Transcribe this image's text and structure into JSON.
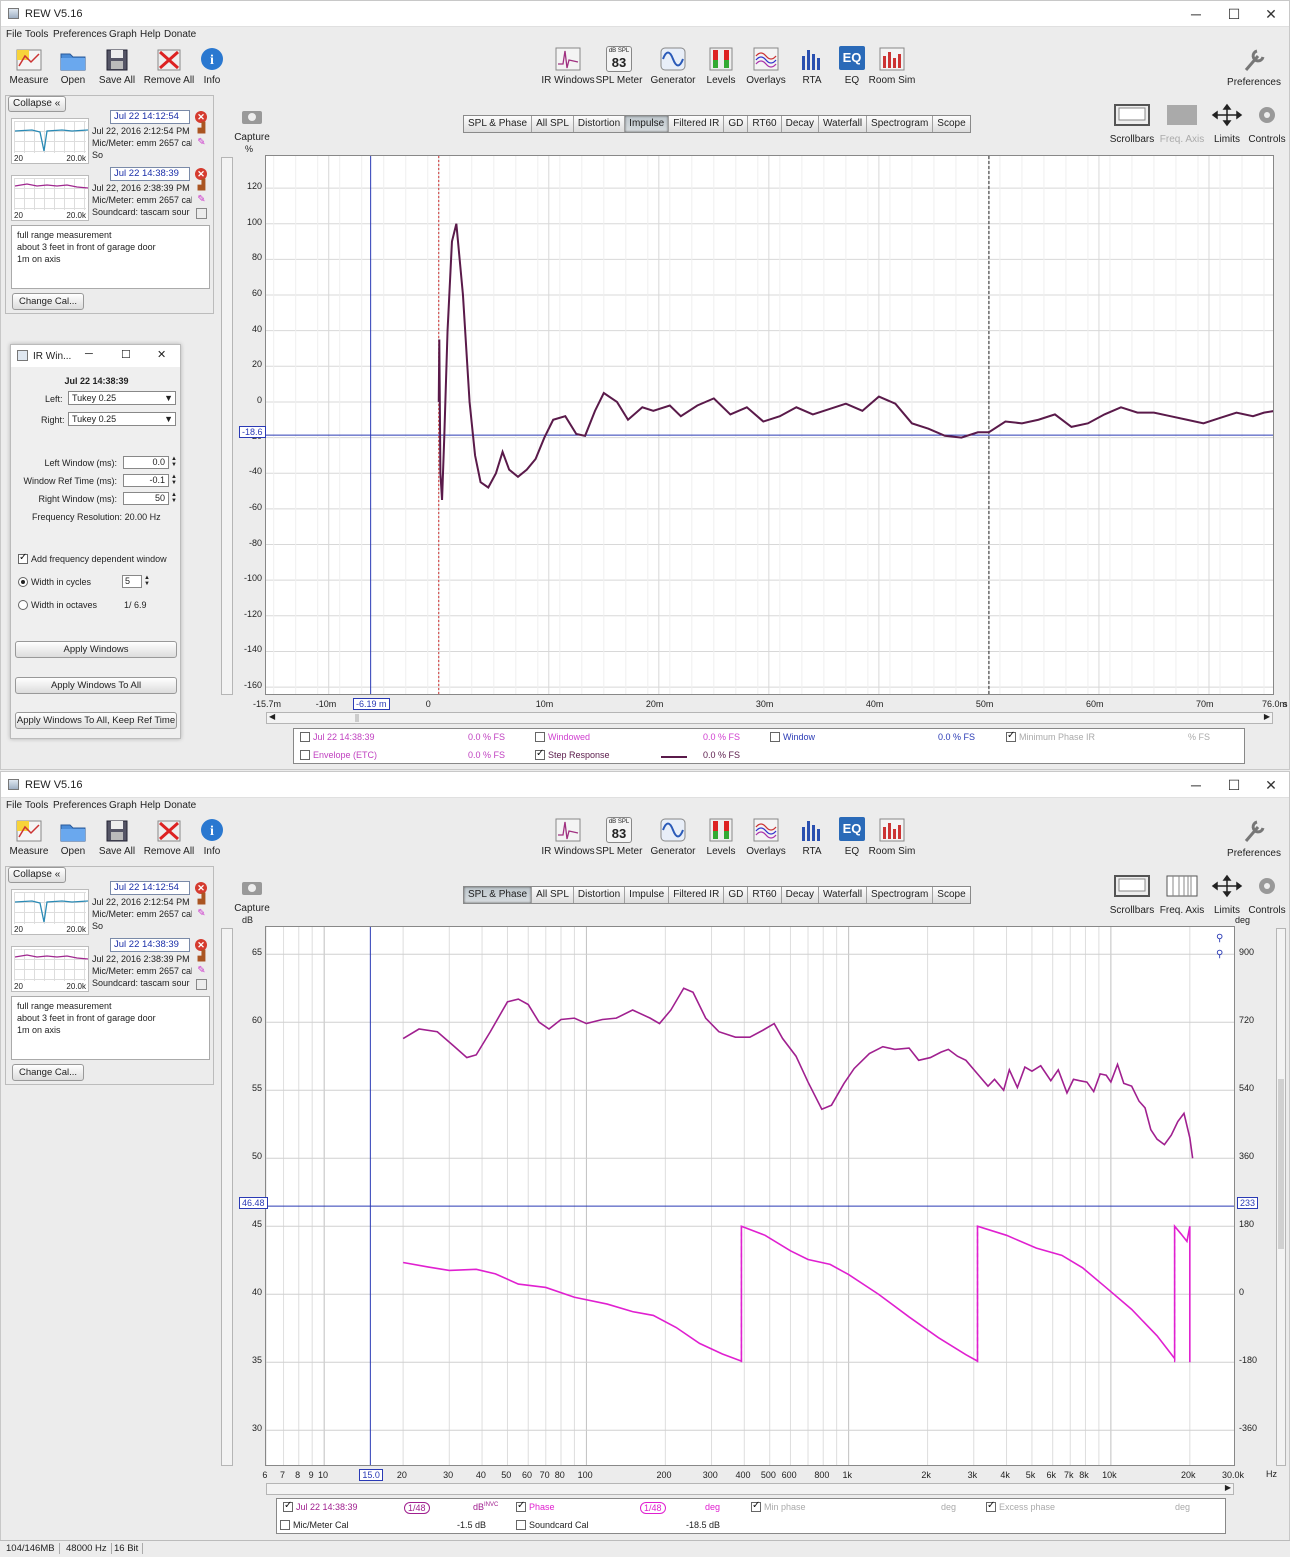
{
  "window_title": "REW V5.16",
  "window_controls": {
    "minimize": "─",
    "maximize": "☐",
    "close": "✕"
  },
  "menus": [
    "File",
    "Tools",
    "Preferences",
    "Graph",
    "Help",
    "Donate"
  ],
  "toolbar_left": [
    "Measure",
    "Open",
    "Save All",
    "Remove All",
    "Info"
  ],
  "toolbar_center": [
    "IR Windows",
    "SPL Meter",
    "Generator",
    "Levels",
    "Overlays",
    "RTA",
    "EQ",
    "Room Sim"
  ],
  "spl_meter": {
    "unit": "dB SPL",
    "value": "83"
  },
  "eq_icon_text": "EQ",
  "preferences_label": "Preferences",
  "capture_label": "Capture",
  "graph_tabs": [
    "SPL & Phase",
    "All SPL",
    "Distortion",
    "Impulse",
    "Filtered IR",
    "GD",
    "RT60",
    "Decay",
    "Waterfall",
    "Spectrogram",
    "Scope"
  ],
  "right_tools": [
    "Scrollbars",
    "Freq. Axis",
    "Limits",
    "Controls"
  ],
  "collapse_label": "Collapse",
  "collapse_icon": "«",
  "measurements": [
    {
      "title": "Jul 22 14:12:54",
      "date": "Jul 22, 2016 2:12:54 PM",
      "mic": "Mic/Meter: emm 2657 cal",
      "sound": "So",
      "thumb_min": "20",
      "thumb_max": "20.0k",
      "color": "#2a8ab5"
    },
    {
      "title": "Jul 22 14:38:39",
      "date": "Jul 22, 2016 2:38:39 PM",
      "mic": "Mic/Meter: emm 2657 cal",
      "sound": "Soundcard: tascam sour",
      "thumb_min": "20",
      "thumb_max": "20.0k",
      "color": "#a0278f"
    }
  ],
  "remove_icon": "✕",
  "notes": [
    "full range measurement",
    "about 3 feet in front of garage door",
    "1m on axis"
  ],
  "change_cal_label": "Change Cal...",
  "ir_window": {
    "title": "IR Win...",
    "measurement": "Jul 22 14:38:39",
    "left_label": "Left:",
    "left_value": "Tukey 0.25",
    "right_label": "Right:",
    "right_value": "Tukey 0.25",
    "left_window_label": "Left Window (ms):",
    "left_window_value": "0.0",
    "ref_time_label": "Window Ref Time (ms):",
    "ref_time_value": "-0.1",
    "right_window_label": "Right Window (ms):",
    "right_window_value": "50",
    "freq_res_label": "Frequency Resolution:",
    "freq_res_value": "20.00 Hz",
    "add_freq_dep": "Add frequency dependent window",
    "width_cycles_label": "Width in cycles",
    "width_cycles_value": "5",
    "width_octaves_label": "Width in octaves",
    "width_octaves_value": "1/ 6.9",
    "apply_windows": "Apply Windows",
    "apply_all": "Apply Windows To All",
    "apply_all_keep": "Apply Windows To All, Keep Ref Time"
  },
  "impulse_graph": {
    "y_unit": "%",
    "y_ticks": [
      "120",
      "100",
      "80",
      "60",
      "40",
      "20",
      "0",
      "-20",
      "-40",
      "-60",
      "-80",
      "-100",
      "-120",
      "-140",
      "-160"
    ],
    "cursor_y": "-18.6",
    "x_ticks": [
      "-15.7m",
      "-10m",
      "0",
      "10m",
      "20m",
      "30m",
      "40m",
      "50m",
      "60m",
      "70m",
      "76.0m"
    ],
    "x_unit": "s",
    "cursor_x": "-6.19 m",
    "line_color": "#5a1a4a",
    "legend": [
      {
        "label": "Jul 22 14:38:39",
        "value": "0.0 % FS",
        "checked": false,
        "color": "#c040c0"
      },
      {
        "label": "Windowed",
        "value": "0.0 % FS",
        "checked": false,
        "color": "#d040d0"
      },
      {
        "label": "Window",
        "value": "0.0 % FS",
        "checked": false,
        "color": "#2a3ab5"
      },
      {
        "label": "Minimum Phase IR",
        "value": "% FS",
        "checked": true,
        "color": "#aaaaaa"
      },
      {
        "label": "Envelope (ETC)",
        "value": "0.0 % FS",
        "checked": false,
        "color": "#c040c0"
      },
      {
        "label": "Step Response",
        "value": "0.0 % FS",
        "checked": true,
        "color": "#5a1a4a"
      }
    ]
  },
  "spl_graph": {
    "y_unit": "dB",
    "y_right_unit": "deg",
    "y_ticks": [
      "65",
      "60",
      "55",
      "50",
      "45",
      "40",
      "35",
      "30"
    ],
    "y_right_ticks": [
      "900",
      "720",
      "540",
      "360",
      "180",
      "0",
      "-180",
      "-360"
    ],
    "cursor_left": "46.48",
    "cursor_right": "233",
    "x_ticks": [
      "6",
      "7",
      "8",
      "9",
      "10",
      "15.0",
      "20",
      "30",
      "40",
      "50",
      "60",
      "70",
      "80",
      "100",
      "200",
      "300",
      "400",
      "500",
      "600",
      "800",
      "1k",
      "2k",
      "3k",
      "4k",
      "5k",
      "6k",
      "7k",
      "8k",
      "10k",
      "20k",
      "30.0k"
    ],
    "x_unit": "Hz",
    "spl_color": "#a0208f",
    "phase_color": "#e020d0",
    "zoom_icons": [
      "zoom-in",
      "zoom-out"
    ],
    "legend": [
      {
        "label": "Jul 22 14:38:39",
        "smooth": "1/48",
        "unit": "dB",
        "sup": "INVC",
        "checked": true
      },
      {
        "label": "Phase",
        "smooth": "1/48",
        "unit": "deg",
        "checked": true
      },
      {
        "label": "Min phase",
        "unit": "deg",
        "checked": true,
        "dim": true
      },
      {
        "label": "Excess phase",
        "unit": "deg",
        "checked": true,
        "dim": true
      },
      {
        "label": "Mic/Meter Cal",
        "value": "-1.5 dB",
        "checked": false
      },
      {
        "label": "Soundcard Cal",
        "value": "-18.5 dB",
        "checked": false
      }
    ]
  },
  "status": {
    "memory": "104/146MB",
    "rate": "48000 Hz",
    "bits": "16 Bit"
  }
}
